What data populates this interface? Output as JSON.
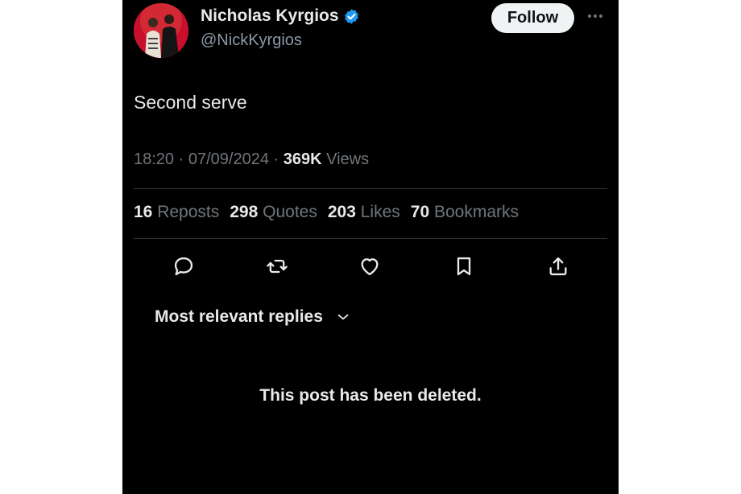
{
  "author": {
    "name": "Nicholas Kyrgios",
    "handle": "@NickKyrgios",
    "verified": true,
    "avatar_icon": "profile-photo-icon"
  },
  "follow_label": "Follow",
  "post": {
    "text": "Second serve",
    "time": "18:20",
    "date": "07/09/2024",
    "views_count": "369K",
    "views_label": "Views"
  },
  "stats": [
    {
      "count": "16",
      "label": "Reposts"
    },
    {
      "count": "298",
      "label": "Quotes"
    },
    {
      "count": "203",
      "label": "Likes"
    },
    {
      "count": "70",
      "label": "Bookmarks"
    }
  ],
  "actions": [
    "reply-icon",
    "repost-icon",
    "like-icon",
    "bookmark-icon",
    "share-icon"
  ],
  "replies_sort": "Most relevant replies",
  "deleted_notice": "This post has been deleted.",
  "colors": {
    "background": "#000000",
    "text": "#e7e9ea",
    "muted": "#71767b",
    "verified": "#1d9bf0",
    "avatar_bg": "#c8102e"
  }
}
